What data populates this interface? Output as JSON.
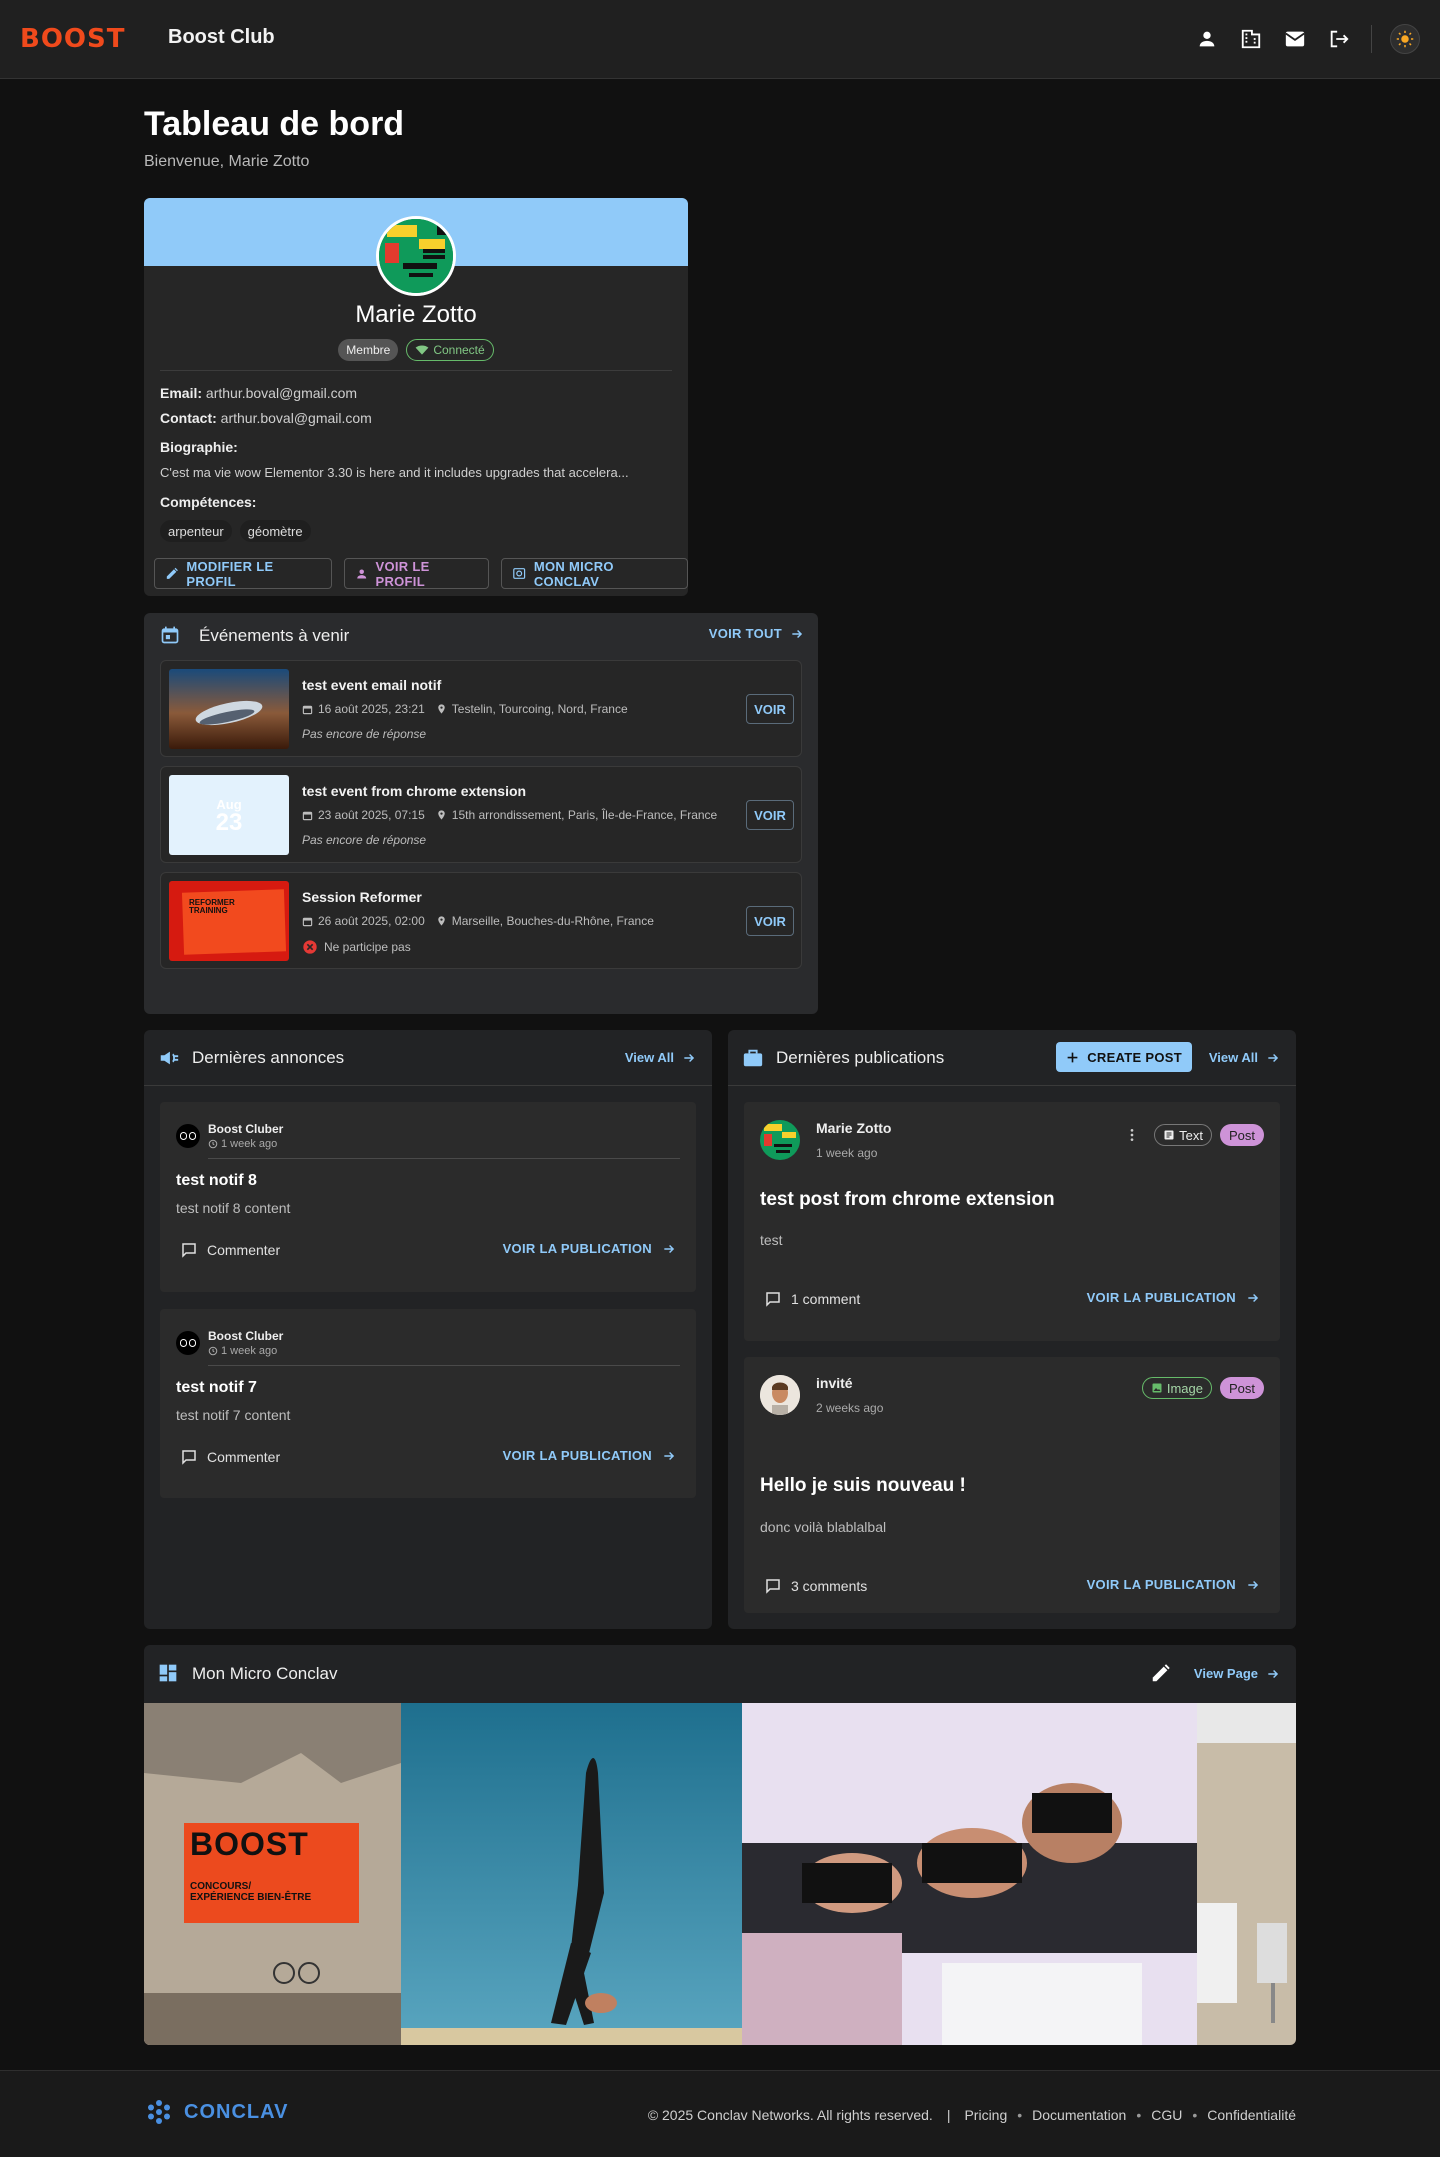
{
  "header": {
    "logo": "BOOST",
    "app_name": "Boost Club",
    "icons": [
      "account-icon",
      "building-icon",
      "mail-icon",
      "logout-icon",
      "sun-icon"
    ]
  },
  "page": {
    "title": "Tableau de bord",
    "subtitle": "Bienvenue, Marie Zotto"
  },
  "profile": {
    "name": "Marie Zotto",
    "role_chip": "Membre",
    "status_chip": "Connecté",
    "email_label": "Email:",
    "email": "arthur.boval@gmail.com",
    "contact_label": "Contact:",
    "contact": "arthur.boval@gmail.com",
    "bio_label": "Biographie:",
    "bio": "C'est ma vie wow Elementor 3.30 is here and it includes upgrades that accelera...",
    "skills_label": "Compétences:",
    "skills": [
      "arpenteur",
      "géomètre"
    ],
    "buttons": {
      "edit": "MODIFIER LE PROFIL",
      "view": "VOIR LE PROFIL",
      "micro": "MON MICRO CONCLAV"
    }
  },
  "events": {
    "title": "Événements à venir",
    "view_all": "VOIR TOUT",
    "button_label": "VOIR",
    "items": [
      {
        "title": "test event email notif",
        "date": "16 août 2025, 23:21",
        "location": "Testelin, Tourcoing, Nord, France",
        "status": "Pas encore de réponse"
      },
      {
        "title": "test event from chrome extension",
        "date": "23 août 2025, 07:15",
        "location": "15th arrondissement, Paris, Île-de-France, France",
        "status": "Pas encore de réponse",
        "thumb_month": "Aug",
        "thumb_day": "23"
      },
      {
        "title": "Session Reformer",
        "date": "26 août 2025, 02:00",
        "location": "Marseille, Bouches-du-Rhône, France",
        "status": "Ne participe pas",
        "thumb_text": "REFORMER TRAINING"
      }
    ]
  },
  "announcements": {
    "title": "Dernières annonces",
    "view_all": "View All",
    "items": [
      {
        "author": "Boost Cluber",
        "time": "1 week ago",
        "title": "test notif 8",
        "content": "test notif 8 content",
        "comment": "Commenter",
        "link": "VOIR LA PUBLICATION"
      },
      {
        "author": "Boost Cluber",
        "time": "1 week ago",
        "title": "test notif 7",
        "content": "test notif 7 content",
        "comment": "Commenter",
        "link": "VOIR LA PUBLICATION"
      }
    ]
  },
  "publications": {
    "title": "Dernières publications",
    "create": "CREATE POST",
    "view_all": "View All",
    "items": [
      {
        "author": "Marie Zotto",
        "time": "1 week ago",
        "type": "Text",
        "kind": "Post",
        "title": "test post from chrome extension",
        "body": "test",
        "comments": "1 comment",
        "link": "VOIR LA PUBLICATION"
      },
      {
        "author": "invité",
        "time": "2 weeks ago",
        "type": "Image",
        "kind": "Post",
        "title": "Hello je suis nouveau !",
        "body": "donc voilà blablalbal",
        "comments": "3 comments",
        "link": "VOIR LA PUBLICATION"
      }
    ]
  },
  "micro": {
    "title": "Mon Micro Conclav",
    "view_page": "View Page",
    "poster": {
      "brand": "BOOST",
      "line1": "CONCOURS/",
      "line2": "EXPÉRIENCE BIEN-ÊTRE"
    }
  },
  "footer": {
    "brand": "CONCLAV",
    "copyright": "© 2025 Conclav Networks. All rights reserved.",
    "separator": "|",
    "links": [
      "Pricing",
      "Documentation",
      "CGU",
      "Confidentialité"
    ]
  },
  "colors": {
    "accent": "#90caf9",
    "brand": "#f04a1c",
    "post_chip": "#ce93d8",
    "connected": "#81c784",
    "footer_brand": "#4a90e2"
  }
}
